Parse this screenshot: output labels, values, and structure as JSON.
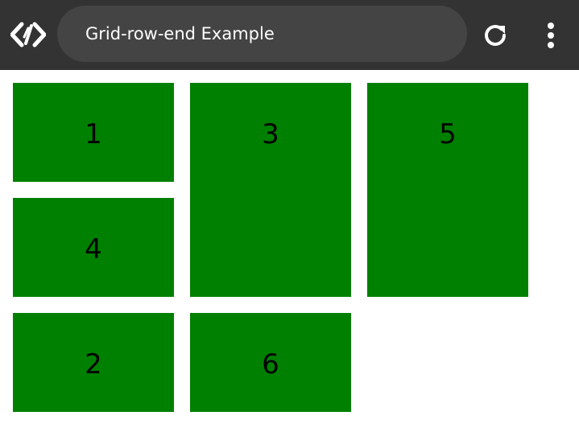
{
  "browser": {
    "address_text": "Grid-row-end Example",
    "logo_icon": "code-logo-icon",
    "reload_icon": "reload-icon",
    "menu_icon": "more-vertical-icon"
  },
  "grid": {
    "items": [
      {
        "label": "1"
      },
      {
        "label": "2"
      },
      {
        "label": "3"
      },
      {
        "label": "4"
      },
      {
        "label": "5"
      },
      {
        "label": "6"
      }
    ],
    "item_color": "#008000"
  },
  "colors": {
    "toolbar_bg": "#333333",
    "urlbar_bg": "#444444",
    "toolbar_text": "#ffffff"
  }
}
